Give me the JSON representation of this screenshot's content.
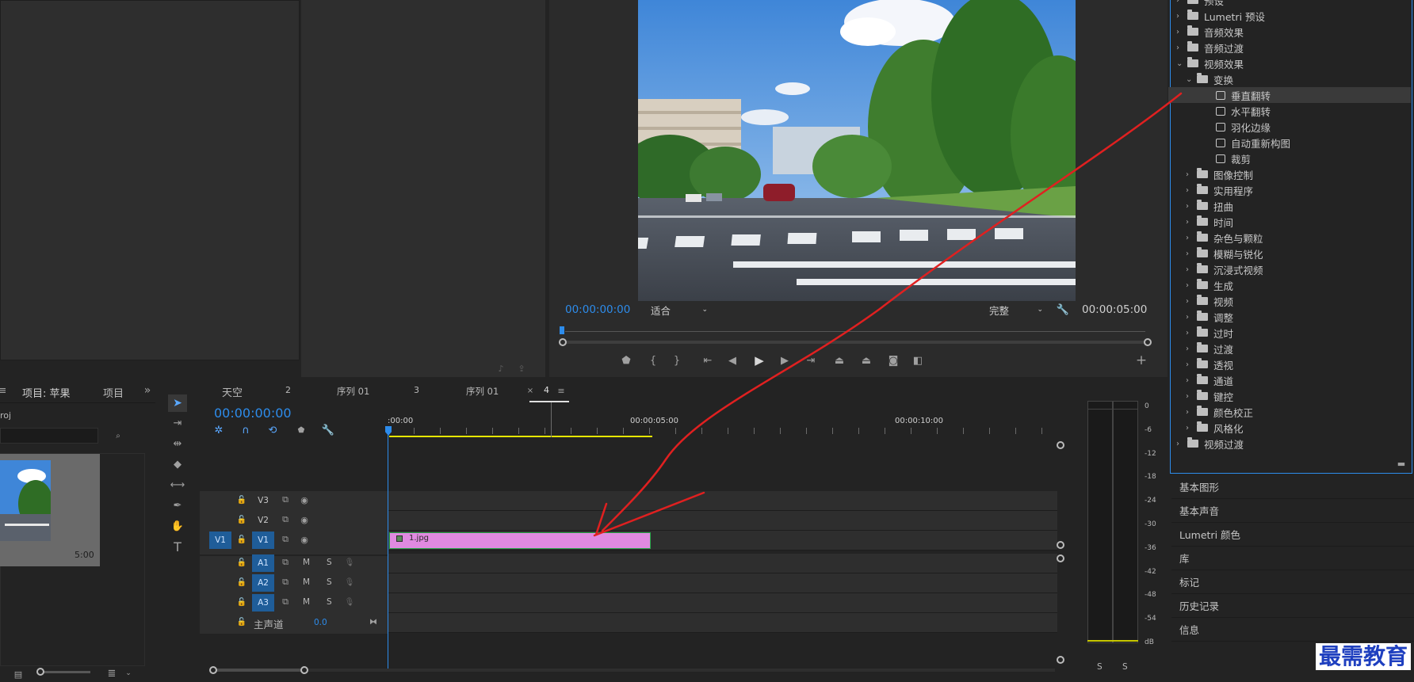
{
  "monitor": {
    "timecode_current": "00:00:00:00",
    "fit_label": "适合",
    "quality_label": "完整",
    "timecode_duration": "00:00:05:00"
  },
  "project": {
    "tab_title": "项目: 苹果",
    "tab_second": "项目",
    "path": "roj",
    "thumb_duration": "5:00"
  },
  "timeline": {
    "tabs": [
      {
        "label": "天空"
      },
      {
        "label": "2"
      },
      {
        "label": "序列 01"
      },
      {
        "label": "3"
      },
      {
        "label": "序列 01"
      },
      {
        "label": "4"
      }
    ],
    "timecode": "00:00:00:00",
    "ruler": [
      ":00:00",
      "00:00:05:00",
      "00:00:10:00"
    ],
    "video_tracks": [
      {
        "name": "V3"
      },
      {
        "name": "V2"
      },
      {
        "name": "V1",
        "source": "V1"
      }
    ],
    "audio_tracks": [
      {
        "name": "A1",
        "m": "M",
        "s": "S"
      },
      {
        "name": "A2",
        "m": "M",
        "s": "S"
      },
      {
        "name": "A3",
        "m": "M",
        "s": "S"
      }
    ],
    "master_label": "主声道",
    "master_value": "0.0",
    "clip_name": "1.jpg"
  },
  "meter": {
    "scale": [
      "0",
      "-6",
      "-12",
      "-18",
      "-24",
      "-30",
      "-36",
      "-42",
      "-48",
      "-54",
      "dB"
    ],
    "solo": [
      "S",
      "S"
    ]
  },
  "effects": {
    "items": [
      {
        "label": "预设",
        "level": 0,
        "type": "folder",
        "open": false
      },
      {
        "label": "Lumetri 预设",
        "level": 0,
        "type": "folder",
        "open": false
      },
      {
        "label": "音频效果",
        "level": 0,
        "type": "folder",
        "open": false
      },
      {
        "label": "音频过渡",
        "level": 0,
        "type": "folder",
        "open": false
      },
      {
        "label": "视频效果",
        "level": 0,
        "type": "folder",
        "open": true
      },
      {
        "label": "变换",
        "level": 1,
        "type": "folder",
        "open": true
      },
      {
        "label": "垂直翻转",
        "level": 2,
        "type": "effect",
        "selected": true
      },
      {
        "label": "水平翻转",
        "level": 2,
        "type": "effect"
      },
      {
        "label": "羽化边缘",
        "level": 2,
        "type": "effect"
      },
      {
        "label": "自动重新构图",
        "level": 2,
        "type": "effect"
      },
      {
        "label": "裁剪",
        "level": 2,
        "type": "effect"
      },
      {
        "label": "图像控制",
        "level": 1,
        "type": "folder",
        "open": false
      },
      {
        "label": "实用程序",
        "level": 1,
        "type": "folder",
        "open": false
      },
      {
        "label": "扭曲",
        "level": 1,
        "type": "folder",
        "open": false
      },
      {
        "label": "时间",
        "level": 1,
        "type": "folder",
        "open": false
      },
      {
        "label": "杂色与颗粒",
        "level": 1,
        "type": "folder",
        "open": false
      },
      {
        "label": "模糊与锐化",
        "level": 1,
        "type": "folder",
        "open": false
      },
      {
        "label": "沉浸式视频",
        "level": 1,
        "type": "folder",
        "open": false
      },
      {
        "label": "生成",
        "level": 1,
        "type": "folder",
        "open": false
      },
      {
        "label": "视频",
        "level": 1,
        "type": "folder",
        "open": false
      },
      {
        "label": "调整",
        "level": 1,
        "type": "folder",
        "open": false
      },
      {
        "label": "过时",
        "level": 1,
        "type": "folder",
        "open": false
      },
      {
        "label": "过渡",
        "level": 1,
        "type": "folder",
        "open": false
      },
      {
        "label": "透视",
        "level": 1,
        "type": "folder",
        "open": false
      },
      {
        "label": "通道",
        "level": 1,
        "type": "folder",
        "open": false
      },
      {
        "label": "键控",
        "level": 1,
        "type": "folder",
        "open": false
      },
      {
        "label": "颜色校正",
        "level": 1,
        "type": "folder",
        "open": false
      },
      {
        "label": "风格化",
        "level": 1,
        "type": "folder",
        "open": false
      },
      {
        "label": "视频过渡",
        "level": 0,
        "type": "folder",
        "open": false
      }
    ]
  },
  "side_panels": [
    "基本图形",
    "基本声音",
    "Lumetri 颜色",
    "库",
    "标记",
    "历史记录",
    "信息"
  ],
  "watermark": "最需教育",
  "colors": {
    "accent": "#2d8ceb",
    "clip": "#e08ae0",
    "annotation": "#e02020",
    "work_area": "#e6e600"
  }
}
